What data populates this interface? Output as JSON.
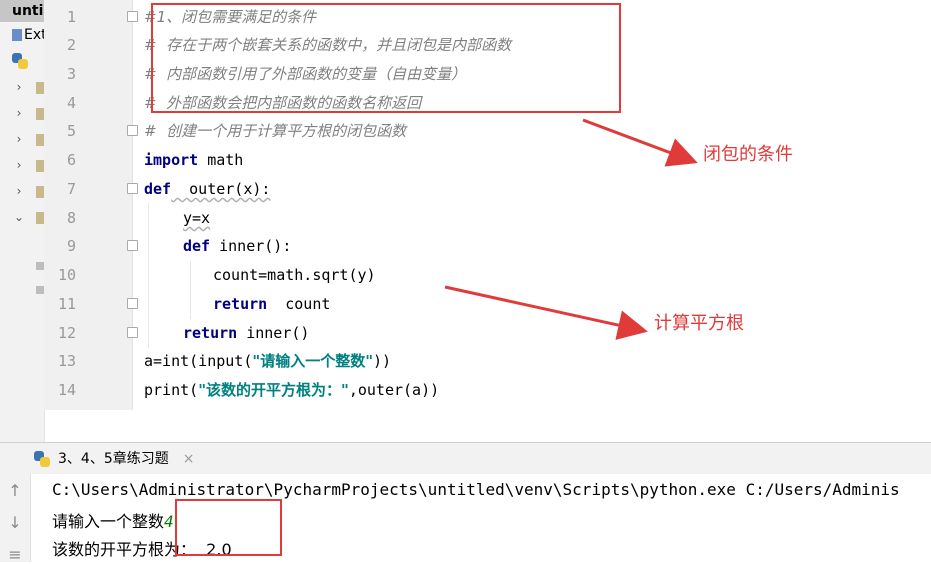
{
  "project": {
    "title": "unti",
    "external": "Exte",
    "py_item": "·"
  },
  "editor": {
    "line_numbers": [
      "1",
      "2",
      "3",
      "4",
      "5",
      "6",
      "7",
      "8",
      "9",
      "10",
      "11",
      "12",
      "13",
      "14"
    ],
    "lines": {
      "l1": "#1、闭包需要满足的条件",
      "l2": "#  存在于两个嵌套关系的函数中，并且闭包是内部函数",
      "l3": "#  内部函数引用了外部函数的变量（自由变量）",
      "l4": "#  外部函数会把内部函数的函数名称返回",
      "l5": "#  创建一个用于计算平方根的闭包函数",
      "l6_kw": "import",
      "l6_rest": " math",
      "l7_kw": "def",
      "l7_rest": "  outer(x):",
      "l8": "y=x",
      "l9_kw": "def",
      "l9_rest": " inner():",
      "l10": "count=math.sqrt(y)",
      "l11_kw": "return",
      "l11_rest": "  count",
      "l12_kw": "return",
      "l12_rest": " inner()",
      "l13_a": "a=int(input(",
      "l13_str": "\"请输入一个整数\"",
      "l13_b": "))",
      "l14_a": "print(",
      "l14_str": "\"该数的开平方根为：\"",
      "l14_b": ",outer(a))"
    }
  },
  "annotations": {
    "conditions": "闭包的条件",
    "sqrt": "计算平方根"
  },
  "run": {
    "tab_label": "3、4、5章练习题",
    "close": "×"
  },
  "console": {
    "line1": "C:\\Users\\Administrator\\PycharmProjects\\untitled\\venv\\Scripts\\python.exe C:/Users/Adminis",
    "line2_prompt": "请输入一个整数",
    "line2_input": "4",
    "line3": "该数的开平方根为：  2.0"
  },
  "colors": {
    "annotation_red": "#e03a3a",
    "keyword": "#000080",
    "string": "#008080",
    "comment": "#808080"
  }
}
